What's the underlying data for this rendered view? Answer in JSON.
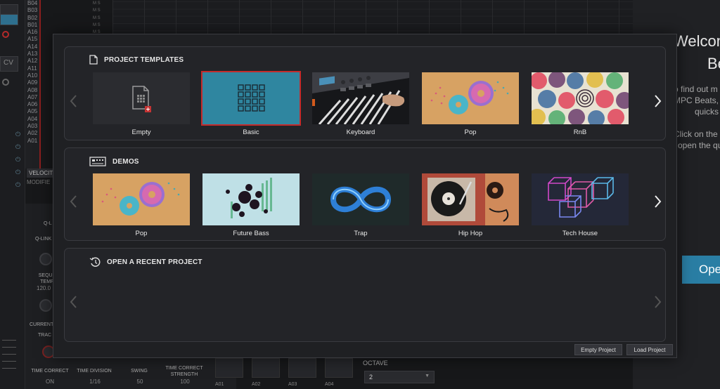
{
  "background_app": {
    "track_labels": [
      "B04",
      "B03",
      "B02",
      "B01",
      "A16",
      "A15",
      "A14",
      "A13",
      "A12",
      "A11",
      "A10",
      "A09",
      "A08",
      "A07",
      "A06",
      "A05",
      "A04",
      "A03",
      "A02",
      "A01"
    ],
    "cv_label": "CV",
    "velocity_label": "VELOCIT",
    "modifier_label": "MODIFIE",
    "q_link_label": "Q-LINK",
    "q_link_tab": "Q-L",
    "sequence_tempo_label": "SEQUE TEMP",
    "sequence_tempo_value": "120.0",
    "current_label": "CURRENT",
    "track_label": "TRAC",
    "knobs": [
      {
        "label": "TIME CORRECT",
        "value": "ON"
      },
      {
        "label": "TIME DIVISION",
        "value": "1/16"
      },
      {
        "label": "SWING",
        "value": "50"
      },
      {
        "label": "TIME CORRECT STRENGTH",
        "value": "100"
      }
    ],
    "pad_labels": [
      "A01",
      "A02",
      "A03",
      "A04"
    ],
    "octave_label": "OCTAVE",
    "octave_value": "2",
    "welcome_line1": "Welcom",
    "welcome_line2": "Be",
    "right_text": [
      "o find out m",
      "MPC Beats,",
      "quicks",
      "Click on the",
      "open the qu"
    ],
    "open_button": "Ope"
  },
  "dialog": {
    "project_templates": {
      "title": "PROJECT TEMPLATES",
      "items": [
        {
          "label": "Empty",
          "thumb": "empty"
        },
        {
          "label": "Basic",
          "thumb": "basic",
          "selected": true
        },
        {
          "label": "Keyboard",
          "thumb": "keyboard"
        },
        {
          "label": "Pop",
          "thumb": "donuts"
        },
        {
          "label": "RnB",
          "thumb": "circles"
        }
      ]
    },
    "demos": {
      "title": "DEMOS",
      "items": [
        {
          "label": "Pop",
          "thumb": "donuts"
        },
        {
          "label": "Future Bass",
          "thumb": "spheres"
        },
        {
          "label": "Trap",
          "thumb": "infinity"
        },
        {
          "label": "Hip Hop",
          "thumb": "turntable"
        },
        {
          "label": "Tech House",
          "thumb": "cubes"
        }
      ]
    },
    "recent": {
      "title": "OPEN A RECENT PROJECT"
    },
    "buttons": {
      "empty_project": "Empty Project",
      "load_project": "Load Project"
    }
  },
  "colors": {
    "selection_outline": "#c42b2b",
    "basic_thumb": "#2f86a0",
    "accent_blue": "#2a7ea4"
  }
}
